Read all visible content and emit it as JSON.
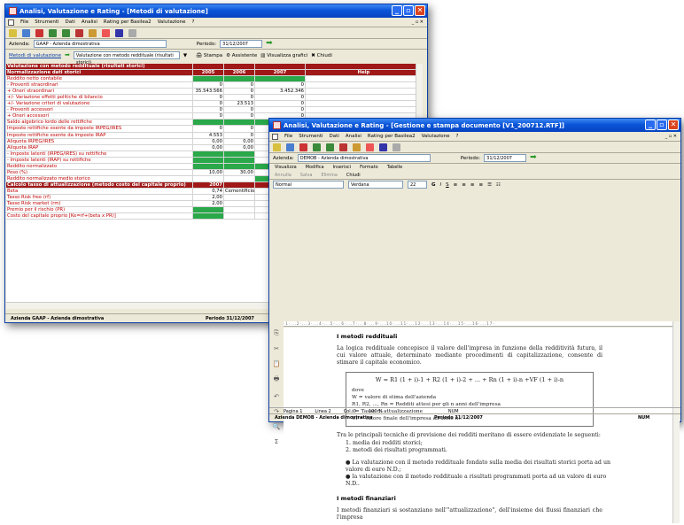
{
  "back": {
    "title": "Analisi, Valutazione e Rating - [Metodi di valutazione]",
    "menu": [
      "File",
      "Strumenti",
      "Dati",
      "Analisi",
      "Rating per Basilea2",
      "Valutazione",
      "?"
    ],
    "mdi": "_ ▫ ✕",
    "azienda_label": "Azienda:",
    "azienda_value": "GAAP - Azienda dimostrativa",
    "periodo_label": "Periodo:",
    "periodo_value": "31/12/2007",
    "method_label": "Metodi di valutazione",
    "method_value": "Valutazione con metodo reddituale (risultati storici)",
    "actions": [
      "Stampa",
      "Assistente",
      "Visualizza grafici",
      "Chiudi"
    ],
    "grid": {
      "header": [
        "Valutazione con metodo reddituale (risultati storici)",
        "",
        "",
        "",
        ""
      ],
      "cols": [
        "Normalizzazione dati storici",
        "2005",
        "2006",
        "2007",
        "Help"
      ],
      "rows": [
        [
          "Reddito netto contabile",
          "",
          "",
          "",
          ""
        ],
        [
          "- Proventi straordinari",
          "0",
          "0",
          "0",
          ""
        ],
        [
          "+ Oneri straordinari",
          "35.543.566",
          "0",
          "3.452.346",
          ""
        ],
        [
          "+/- Variazione effetti politiche di bilancio",
          "0",
          "0",
          "0",
          ""
        ],
        [
          "+/- Variazione criteri di valutazione",
          "0",
          "23.513",
          "0",
          ""
        ],
        [
          "- Proventi accessori",
          "0",
          "0",
          "0",
          ""
        ],
        [
          "+ Oneri accessori",
          "0",
          "0",
          "0",
          ""
        ],
        [
          "Saldo algebrico lordo delle rettifiche",
          "",
          "",
          "",
          ""
        ],
        [
          "Imposte rettifiche esente da imposte IRPEG/IRES",
          "0",
          "0",
          "",
          ""
        ],
        [
          "Imposte rettifiche esente da imposte IRAP",
          "4.553",
          "0",
          "",
          ""
        ],
        [
          "Aliquota IRPEG/IRES",
          "0,00",
          "0,00",
          "",
          ""
        ],
        [
          "Aliquota IRAP",
          "0,00",
          "0,00",
          "",
          ""
        ],
        [
          "- Imposte latenti (IRPEG/IRES) su rettifiche",
          "",
          "",
          "",
          ""
        ],
        [
          "- Imposte latenti (IRAP) su rettifiche",
          "",
          "",
          "",
          ""
        ],
        [
          "Reddito normalizzato",
          "",
          "",
          "",
          ""
        ],
        [
          "Peso (%)",
          "10,00",
          "30,00",
          "",
          ""
        ],
        [
          "Reddito normalizzato medio storico",
          "",
          "",
          "",
          ""
        ]
      ],
      "sec2": [
        "Calcolo tasso di attualizzazione (metodo costo del capitale proprio)",
        "2007",
        "",
        "",
        ""
      ],
      "rows2": [
        [
          "Beta",
          "0,74",
          "Cementificio",
          "",
          ""
        ],
        [
          "Tasso Risk free (rf)",
          "2,00",
          "",
          "",
          ""
        ],
        [
          "Tasso Risk market (rm)",
          "2,00",
          "",
          "",
          ""
        ],
        [
          "Premio per il rischio (PR)",
          "",
          "",
          "",
          ""
        ],
        [
          "Costo del capitale proprio [Ke=rf+(beta x PR)]",
          "",
          "",
          "",
          ""
        ]
      ]
    },
    "status": [
      "Azienda GAAP - Azienda dimostrativa",
      "Periodo 31/12/2007"
    ]
  },
  "front": {
    "title": "Analisi, Valutazione e Rating - [Gestione e stampa documento [V1_200712.RTF]]",
    "menu": [
      "File",
      "Strumenti",
      "Dati",
      "Analisi",
      "Rating per Basilea2",
      "Valutazione",
      "?"
    ],
    "azienda_label": "Azienda:",
    "azienda_value": "DEMOB - Azienda dimostrativa",
    "periodo_label": "Periodo:",
    "periodo_value": "31/12/2007",
    "ribbon": [
      "Visualizza",
      "Modifica",
      "Inserisci",
      "Formato",
      "Tabelle"
    ],
    "actions": [
      "Annulla",
      "Salva",
      "Elimina",
      "Chiudi"
    ],
    "style": "Normal",
    "font": "Verdana",
    "size": "22",
    "ruler": "·1·...2·...3·...4·...5·...6·...7·...8·...9·...10·...11·...12·...13·...14·...15·...16·...17·",
    "doc": {
      "h1": "I metodi reddituali",
      "p1": "La logica reddituale concepisce il valore dell'impresa in funzione della redditività futura, il cui valore attuale, determinato mediante procedimenti di capitalizzazione, consente di stimare il capitale economico.",
      "formula": "W = R1 (1 + i)-1 + R2 (1 + i)-2 + ... + Rn (1 + i)-n +VF (1 + i)-n",
      "f_lines": [
        "dove",
        "W = valore di stima dell'azienda",
        "R1, R2, ..., Rn = Redditi attesi per gli n anni dell'impresa",
        "i = Tasso di attualizzazione",
        "VF= Valore finale dell'impresa all'anno n."
      ],
      "p2": "Tra le principali tecniche di previsione dei redditi meritano di essere evidenziate le seguenti:",
      "list": [
        "1. media dei redditi storici;",
        "2. metodi dei risultati programmati."
      ],
      "bullets": [
        "La valutazione con il metodo reddituale fondato sulla media dei risultati storici porta ad un valore di euro N.D.;",
        "la valutazione con il metodo reddituale a risultati programmati porta ad un valore di euro N.D.."
      ],
      "h2": "I metodi finanziari",
      "p3": "I metodi finanziari si sostanziano nell'\"attualizzazione\", dell'insieme dei flussi finanziari che l'impresa"
    },
    "statusbar": [
      "Pagina 1",
      "Linea 2",
      "Col. 0",
      "100 %",
      "NUM"
    ],
    "status": [
      "Azienda DEMOB - Azienda dimostrativa",
      "Periodo 31/12/2007",
      "NUM"
    ]
  }
}
